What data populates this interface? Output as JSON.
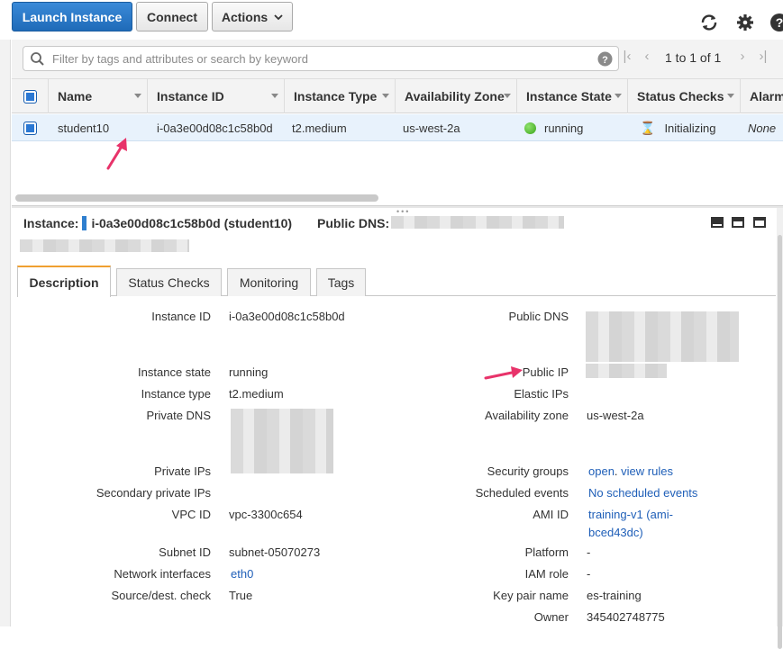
{
  "toolbar": {
    "launch_label": "Launch Instance",
    "connect_label": "Connect",
    "actions_label": "Actions"
  },
  "search": {
    "placeholder": "Filter by tags and attributes or search by keyword",
    "pagination": "1 to 1 of 1"
  },
  "table": {
    "headers": [
      "Name",
      "Instance ID",
      "Instance Type",
      "Availability Zone",
      "Instance State",
      "Status Checks",
      "Alarm"
    ],
    "row": {
      "name": "student10",
      "instance_id": "i-0a3e00d08c1c58b0d",
      "instance_type": "t2.medium",
      "availability_zone": "us-west-2a",
      "instance_state": "running",
      "status_checks": "Initializing",
      "alarm": "None"
    }
  },
  "detail": {
    "instance_label": "Instance:",
    "instance_value": "i-0a3e00d08c1c58b0d (student10)",
    "public_dns_label": "Public DNS:"
  },
  "tabs": [
    "Description",
    "Status Checks",
    "Monitoring",
    "Tags"
  ],
  "description": {
    "left": [
      {
        "label": "Instance ID",
        "value": "i-0a3e00d08c1c58b0d"
      },
      {
        "label": "Instance state",
        "value": "running"
      },
      {
        "label": "Instance type",
        "value": "t2.medium"
      },
      {
        "label": "Private DNS",
        "value": ""
      },
      {
        "label": "Private IPs",
        "value": ""
      },
      {
        "label": "Secondary private IPs",
        "value": ""
      },
      {
        "label": "VPC ID",
        "value": "vpc-3300c654"
      },
      {
        "label": "Subnet ID",
        "value": "subnet-05070273"
      },
      {
        "label": "Network interfaces",
        "value": "eth0"
      },
      {
        "label": "Source/dest. check",
        "value": "True"
      }
    ],
    "right": [
      {
        "label": "Public DNS",
        "value": ""
      },
      {
        "label": "Public IP",
        "value": ""
      },
      {
        "label": "Elastic IPs",
        "value": ""
      },
      {
        "label": "Availability zone",
        "value": "us-west-2a"
      },
      {
        "label": "Security groups",
        "value": "open",
        "value2": "view rules"
      },
      {
        "label": "Scheduled events",
        "value": "No scheduled events"
      },
      {
        "label": "AMI ID",
        "value": "training-v1 (ami-",
        "value2": "bced43dc)"
      },
      {
        "label": "Platform",
        "value": "-"
      },
      {
        "label": "IAM role",
        "value": "-"
      },
      {
        "label": "Key pair name",
        "value": "es-training"
      },
      {
        "label": "Owner",
        "value": "345402748775"
      }
    ]
  },
  "colors": {
    "primary": "#2a7bcc",
    "row_highlight": "#e8f2fc",
    "annotation_arrow": "#e8336a",
    "link": "#1f5fb8"
  }
}
